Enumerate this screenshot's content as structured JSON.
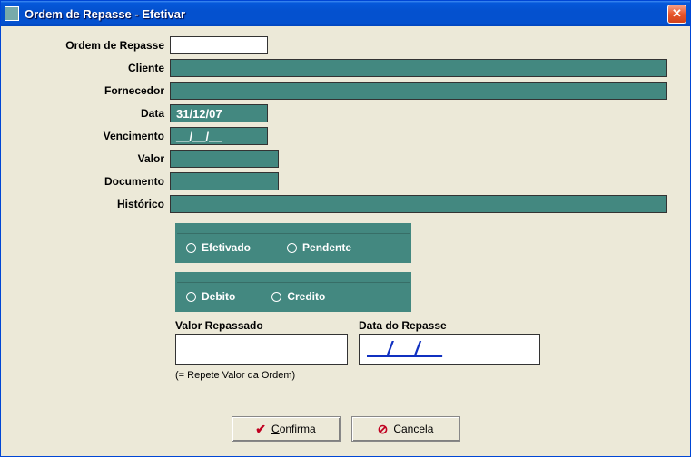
{
  "window": {
    "title": "Ordem de Repasse - Efetivar"
  },
  "labels": {
    "ordem": "Ordem de Repasse",
    "cliente": "Cliente",
    "fornecedor": "Fornecedor",
    "data": "Data",
    "vencimento": "Vencimento",
    "valor": "Valor",
    "documento": "Documento",
    "historico": "Histórico",
    "valor_repassado": "Valor Repassado",
    "data_repasse": "Data do Repasse",
    "hint": "(= Repete Valor da Ordem)"
  },
  "values": {
    "ordem": "",
    "cliente": "",
    "fornecedor": "",
    "data": "31/12/07",
    "vencimento": "__/__/__",
    "valor": "",
    "documento": "",
    "historico": "",
    "valor_repassado": "",
    "data_repasse": "__/__/__"
  },
  "radios": {
    "status": {
      "efetivado": "Efetivado",
      "pendente": "Pendente"
    },
    "tipo": {
      "debito": "Debito",
      "credito": "Credito"
    }
  },
  "buttons": {
    "confirma_u": "C",
    "confirma_rest": "onfirma",
    "cancela": "Cancela"
  }
}
